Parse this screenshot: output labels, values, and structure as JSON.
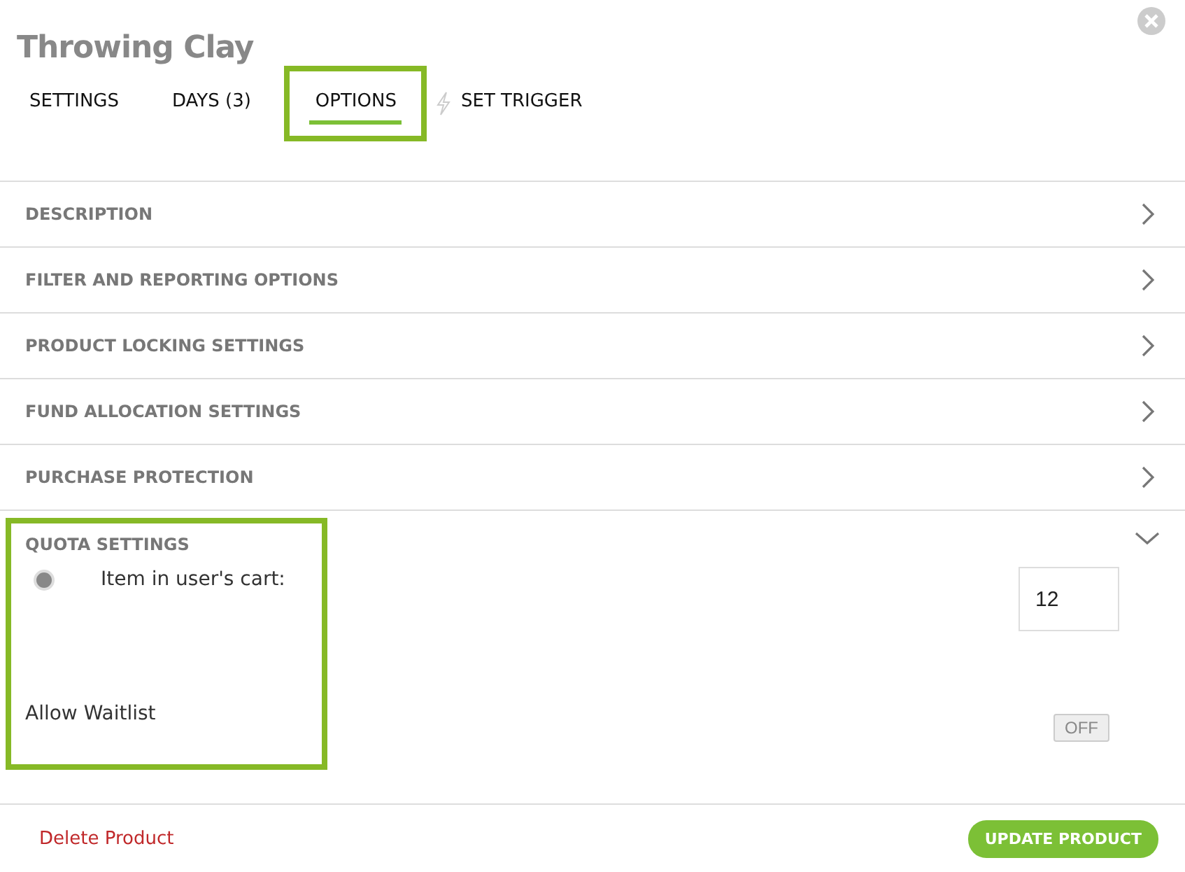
{
  "title": "Throwing Clay",
  "tabs": [
    {
      "label": "SETTINGS",
      "selected": false,
      "highlighted": false,
      "kind": "plain"
    },
    {
      "label": "DAYS (3)",
      "selected": false,
      "highlighted": false,
      "kind": "plain"
    },
    {
      "label": "OPTIONS",
      "selected": true,
      "highlighted": true,
      "kind": "plain"
    },
    {
      "label": "SET TRIGGER",
      "selected": false,
      "highlighted": false,
      "kind": "trigger"
    }
  ],
  "sections": [
    {
      "label": "DESCRIPTION",
      "expanded": false
    },
    {
      "label": "FILTER AND REPORTING OPTIONS",
      "expanded": false
    },
    {
      "label": "PRODUCT LOCKING SETTINGS",
      "expanded": false
    },
    {
      "label": "FUND ALLOCATION SETTINGS",
      "expanded": false
    },
    {
      "label": "PURCHASE PROTECTION",
      "expanded": false
    }
  ],
  "quota": {
    "label": "QUOTA SETTINGS",
    "expanded": true,
    "highlighted": true,
    "option": {
      "label": "Item in user's cart:",
      "selected": true,
      "value": "12"
    },
    "waitlist": {
      "label": "Allow Waitlist",
      "on": false,
      "toggle_text": "OFF"
    }
  },
  "footer": {
    "delete": "Delete Product",
    "update": "UPDATE PRODUCT"
  }
}
